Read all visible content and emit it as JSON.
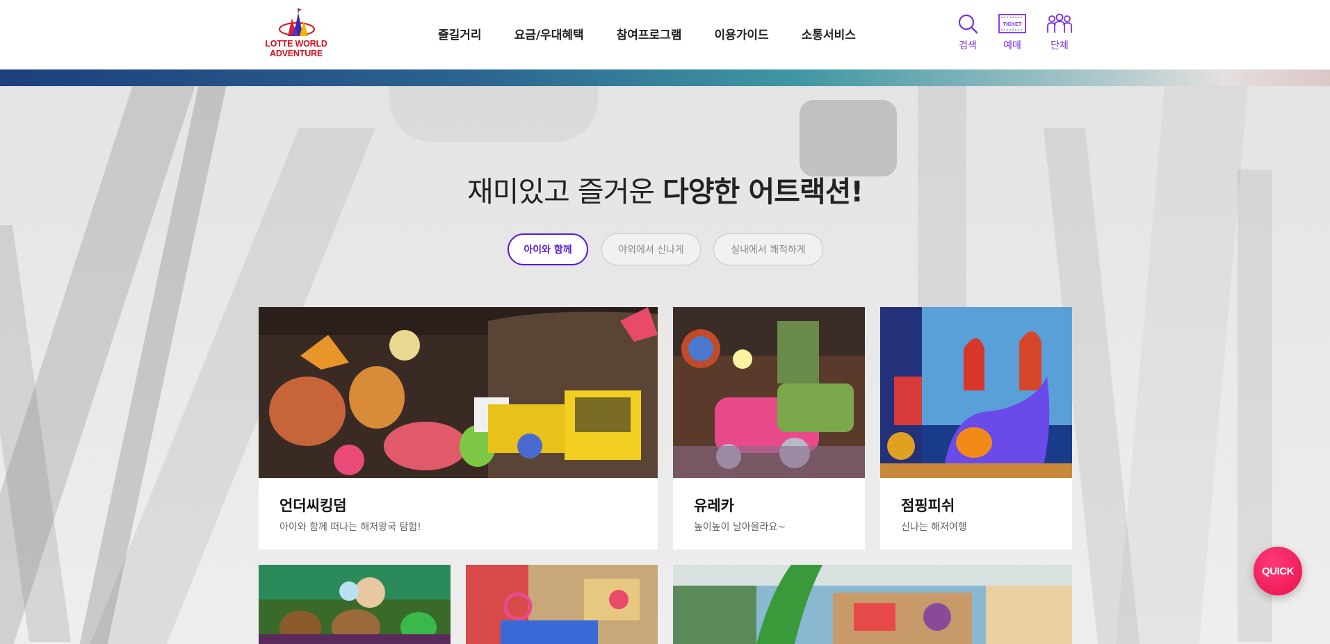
{
  "header": {
    "logo_text": "LOTTE WORLD ADVENTURE",
    "nav": [
      "즐길거리",
      "요금/우대혜택",
      "참여프로그램",
      "이용가이드",
      "소통서비스"
    ],
    "utils": [
      {
        "label": "검색",
        "icon": "search-icon"
      },
      {
        "label": "예매",
        "icon": "ticket-icon",
        "icon_text": "TICKET"
      },
      {
        "label": "단체",
        "icon": "group-icon"
      }
    ]
  },
  "section": {
    "heading_light": "재미있고 즐거운 ",
    "heading_bold": "다양한 어트랙션!",
    "tabs": [
      "아이와 함께",
      "야외에서 신나게",
      "실내에서 쾌적하게"
    ],
    "active_tab": "아이와 함께"
  },
  "cards": [
    {
      "title": "언더씨킹덤",
      "desc": "아이와 함께 떠나는 해저왕국 탐험!"
    },
    {
      "title": "유레카",
      "desc": "높이높이 날아올라요~"
    },
    {
      "title": "점핑피쉬",
      "desc": "신나는 해저여행"
    }
  ],
  "quick_label": "QUICK",
  "colors": {
    "accent": "#5a17d8",
    "util_label": "#7a2ce8",
    "logo_red": "#d4101d",
    "quick_button": "#e8104c"
  }
}
